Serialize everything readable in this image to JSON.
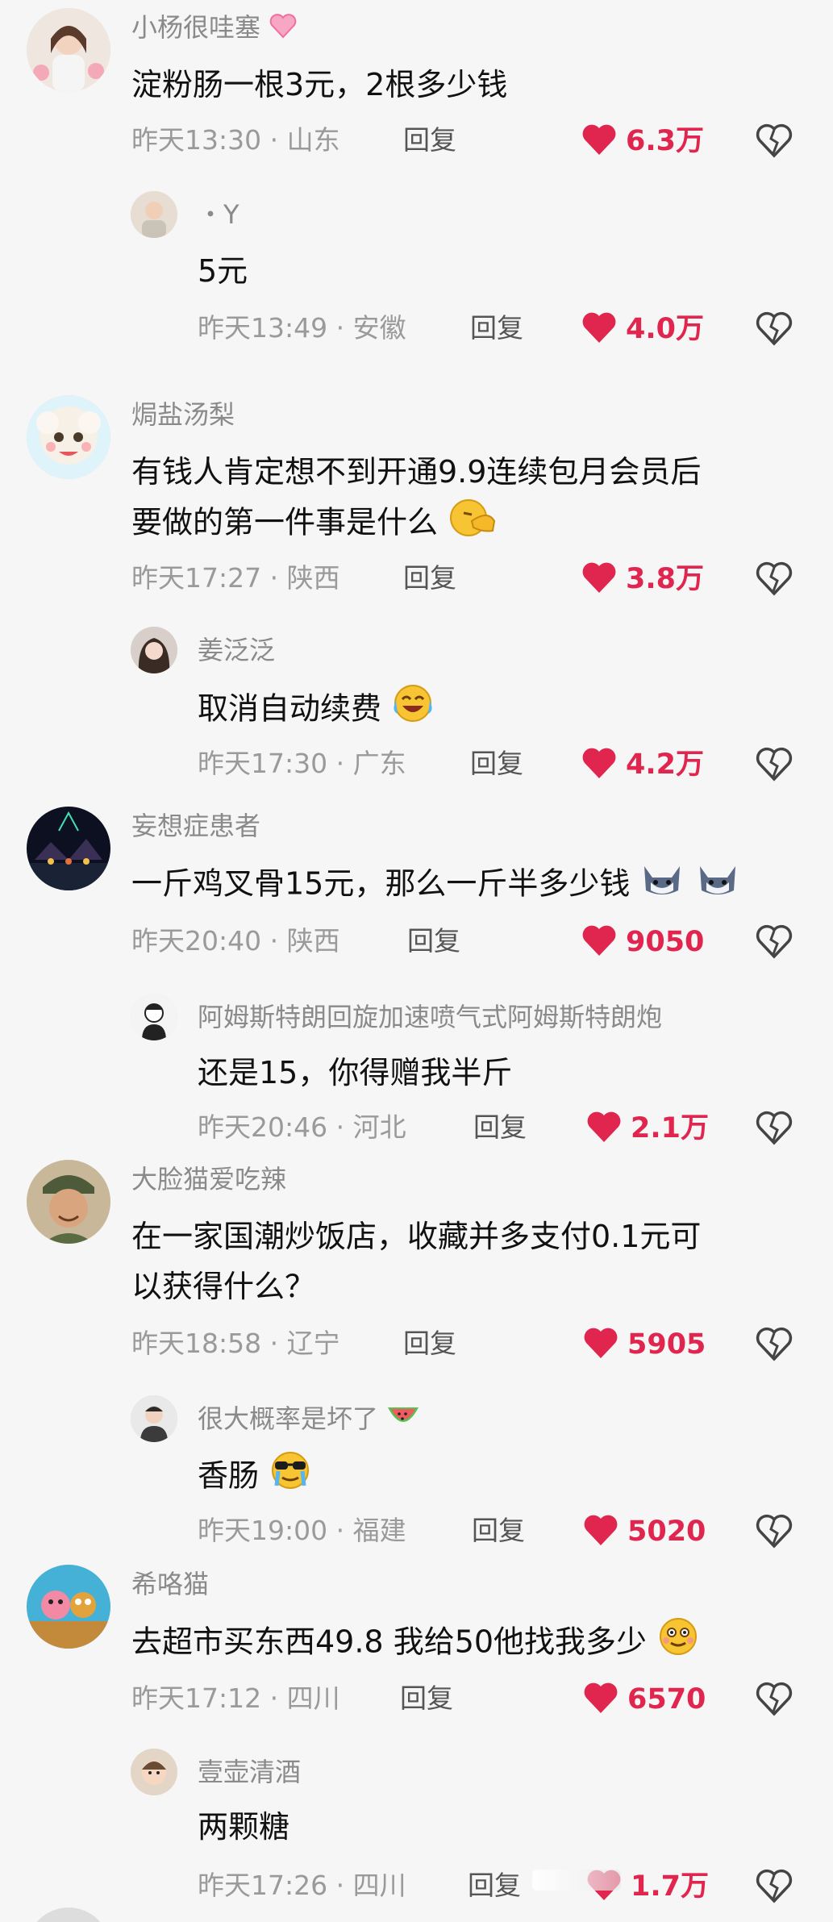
{
  "colors": {
    "like_red": "#e0264e",
    "meta_gray": "#9a9a9a",
    "name_gray": "#8a8a8a"
  },
  "icons": {
    "like": "heart-icon",
    "dislike": "broken-heart-icon"
  },
  "comments": [
    {
      "user": "小杨很哇塞",
      "text": "淀粉肠一根3元，2根多少钱",
      "time": "昨天13:30",
      "location": "山东",
      "reply_label": "回复",
      "likes": "6.3万",
      "reply": {
        "user": "・Y",
        "text": "5元",
        "time": "昨天13:49",
        "location": "安徽",
        "reply_label": "回复",
        "likes": "4.0万"
      }
    },
    {
      "user": "焗盐汤梨",
      "text_line1": "有钱人肯定想不到开通9.9连续包月会员后",
      "text_line2": "要做的第一件事是什么",
      "time": "昨天17:27",
      "location": "陕西",
      "reply_label": "回复",
      "likes": "3.8万",
      "reply": {
        "user": "姜泛泛",
        "text": "取消自动续费",
        "time": "昨天17:30",
        "location": "广东",
        "reply_label": "回复",
        "likes": "4.2万"
      }
    },
    {
      "user": "妄想症患者",
      "text": "一斤鸡叉骨15元，那么一斤半多少钱",
      "time": "昨天20:40",
      "location": "陕西",
      "reply_label": "回复",
      "likes": "9050",
      "reply": {
        "user": "阿姆斯特朗回旋加速喷气式阿姆斯特朗炮",
        "text": "还是15，你得赠我半斤",
        "time": "昨天20:46",
        "location": "河北",
        "reply_label": "回复",
        "likes": "2.1万"
      }
    },
    {
      "user": "大脸猫爱吃辣",
      "text_line1": "在一家国潮炒饭店，收藏并多支付0.1元可",
      "text_line2": "以获得什么？",
      "time": "昨天18:58",
      "location": "辽宁",
      "reply_label": "回复",
      "likes": "5905",
      "reply": {
        "user": "很大概率是坏了",
        "text": "香肠",
        "time": "昨天19:00",
        "location": "福建",
        "reply_label": "回复",
        "likes": "5020"
      }
    },
    {
      "user": "希咯猫",
      "text": "去超市买东西49.8 我给50他找我多少",
      "time": "昨天17:12",
      "location": "四川",
      "reply_label": "回复",
      "likes": "6570",
      "reply": {
        "user": "壹壶清酒",
        "text": "两颗糖",
        "time": "昨天17:26",
        "location": "四川",
        "reply_label": "回复",
        "likes": "1.7万"
      }
    }
  ]
}
